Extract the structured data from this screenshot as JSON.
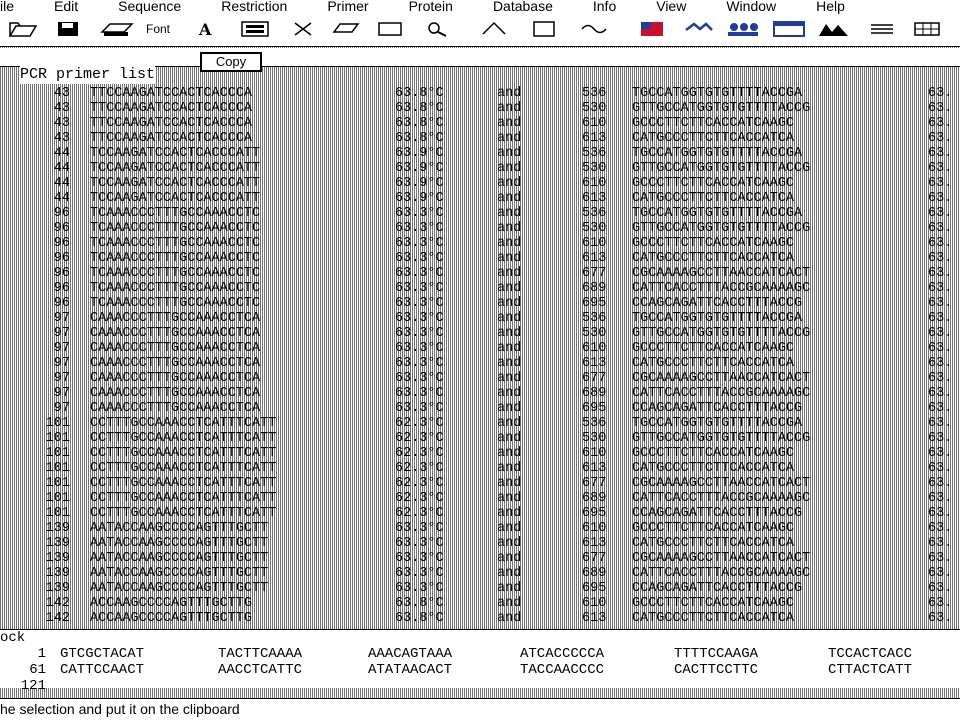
{
  "menu": [
    "ile",
    "Edit",
    "Sequence",
    "Restriction",
    "Primer",
    "Protein",
    "Database",
    "Info",
    "View",
    "Window",
    "Help"
  ],
  "toolbar": {
    "font_label": "Font",
    "icons": [
      "open-folder-icon",
      "save-disk-icon",
      "print-icon",
      "font-icon",
      "clipboard-icon",
      "cut-icon",
      "copy-icon",
      "paste-icon",
      "search-icon",
      "flag-icon",
      "bird-icon",
      "people-icon",
      "window-icon",
      "mountains-icon",
      "lines-icon",
      "grid-icon"
    ]
  },
  "copy_button": "Copy",
  "list_title": "PCR primer list",
  "primers": [
    {
      "pos": "43",
      "seq": "TTCCAAGATCCACTCACCCA",
      "tm": "63.8°C",
      "and": "and",
      "pos2": "536",
      "seq2": "TGCCATGGTGTGTTTTACCGA",
      "tm2": "63."
    },
    {
      "pos": "43",
      "seq": "TTCCAAGATCCACTCACCCA",
      "tm": "63.8°C",
      "and": "and",
      "pos2": "530",
      "seq2": "GTTGCCATGGTGTGTTTTACCG",
      "tm2": "63."
    },
    {
      "pos": "43",
      "seq": "TTCCAAGATCCACTCACCCA",
      "tm": "63.8°C",
      "and": "and",
      "pos2": "610",
      "seq2": "GCCCTTCTTCACCATCAAGC",
      "tm2": "63."
    },
    {
      "pos": "43",
      "seq": "TTCCAAGATCCACTCACCCA",
      "tm": "63.8°C",
      "and": "and",
      "pos2": "613",
      "seq2": "CATGCCCTTCTTCACCATCA",
      "tm2": "63."
    },
    {
      "pos": "44",
      "seq": "TCCAAGATCCACTCACCCATT",
      "tm": "63.9°C",
      "and": "and",
      "pos2": "536",
      "seq2": "TGCCATGGTGTGTTTTACCGA",
      "tm2": "63."
    },
    {
      "pos": "44",
      "seq": "TCCAAGATCCACTCACCCATT",
      "tm": "63.9°C",
      "and": "and",
      "pos2": "530",
      "seq2": "GTTGCCATGGTGTGTTTTACCG",
      "tm2": "63."
    },
    {
      "pos": "44",
      "seq": "TCCAAGATCCACTCACCCATT",
      "tm": "63.9°C",
      "and": "and",
      "pos2": "610",
      "seq2": "GCCCTTCTTCACCATCAAGC",
      "tm2": "63."
    },
    {
      "pos": "44",
      "seq": "TCCAAGATCCACTCACCCATT",
      "tm": "63.9°C",
      "and": "and",
      "pos2": "613",
      "seq2": "CATGCCCTTCTTCACCATCA",
      "tm2": "63."
    },
    {
      "pos": "96",
      "seq": "TCAAACCCTTTGCCAAACCTC",
      "tm": "63.3°C",
      "and": "and",
      "pos2": "536",
      "seq2": "TGCCATGGTGTGTTTTACCGA",
      "tm2": "63."
    },
    {
      "pos": "96",
      "seq": "TCAAACCCTTTGCCAAACCTC",
      "tm": "63.3°C",
      "and": "and",
      "pos2": "530",
      "seq2": "GTTGCCATGGTGTGTTTTACCG",
      "tm2": "63."
    },
    {
      "pos": "96",
      "seq": "TCAAACCCTTTGCCAAACCTC",
      "tm": "63.3°C",
      "and": "and",
      "pos2": "610",
      "seq2": "GCCCTTCTTCACCATCAAGC",
      "tm2": "63."
    },
    {
      "pos": "96",
      "seq": "TCAAACCCTTTGCCAAACCTC",
      "tm": "63.3°C",
      "and": "and",
      "pos2": "613",
      "seq2": "CATGCCCTTCTTCACCATCA",
      "tm2": "63."
    },
    {
      "pos": "96",
      "seq": "TCAAACCCTTTGCCAAACCTC",
      "tm": "63.3°C",
      "and": "and",
      "pos2": "677",
      "seq2": "CGCAAAAGCCTTAACCATCACT",
      "tm2": "63."
    },
    {
      "pos": "96",
      "seq": "TCAAACCCTTTGCCAAACCTC",
      "tm": "63.3°C",
      "and": "and",
      "pos2": "689",
      "seq2": "CATTCACCTTTACCGCAAAAGC",
      "tm2": "63."
    },
    {
      "pos": "96",
      "seq": "TCAAACCCTTTGCCAAACCTC",
      "tm": "63.3°C",
      "and": "and",
      "pos2": "695",
      "seq2": "CCAGCAGATTCACCTTTACCG",
      "tm2": "63."
    },
    {
      "pos": "97",
      "seq": "CAAACCCTTTGCCAAACCTCA",
      "tm": "63.3°C",
      "and": "and",
      "pos2": "536",
      "seq2": "TGCCATGGTGTGTTTTACCGA",
      "tm2": "63."
    },
    {
      "pos": "97",
      "seq": "CAAACCCTTTGCCAAACCTCA",
      "tm": "63.3°C",
      "and": "and",
      "pos2": "530",
      "seq2": "GTTGCCATGGTGTGTTTTACCG",
      "tm2": "63."
    },
    {
      "pos": "97",
      "seq": "CAAACCCTTTGCCAAACCTCA",
      "tm": "63.3°C",
      "and": "and",
      "pos2": "610",
      "seq2": "GCCCTTCTTCACCATCAAGC",
      "tm2": "63."
    },
    {
      "pos": "97",
      "seq": "CAAACCCTTTGCCAAACCTCA",
      "tm": "63.3°C",
      "and": "and",
      "pos2": "613",
      "seq2": "CATGCCCTTCTTCACCATCA",
      "tm2": "63."
    },
    {
      "pos": "97",
      "seq": "CAAACCCTTTGCCAAACCTCA",
      "tm": "63.3°C",
      "and": "and",
      "pos2": "677",
      "seq2": "CGCAAAAGCCTTAACCATCACT",
      "tm2": "63."
    },
    {
      "pos": "97",
      "seq": "CAAACCCTTTGCCAAACCTCA",
      "tm": "63.3°C",
      "and": "and",
      "pos2": "689",
      "seq2": "CATTCACCTTTACCGCAAAAGC",
      "tm2": "63."
    },
    {
      "pos": "97",
      "seq": "CAAACCCTTTGCCAAACCTCA",
      "tm": "63.3°C",
      "and": "and",
      "pos2": "695",
      "seq2": "CCAGCAGATTCACCTTTACCG",
      "tm2": "63."
    },
    {
      "pos": "101",
      "seq": "CCTTTGCCAAACCTCATTTCATT",
      "tm": "62.3°C",
      "and": "and",
      "pos2": "536",
      "seq2": "TGCCATGGTGTGTTTTACCGA",
      "tm2": "63."
    },
    {
      "pos": "101",
      "seq": "CCTTTGCCAAACCTCATTTCATT",
      "tm": "62.3°C",
      "and": "and",
      "pos2": "530",
      "seq2": "GTTGCCATGGTGTGTTTTACCG",
      "tm2": "63."
    },
    {
      "pos": "101",
      "seq": "CCTTTGCCAAACCTCATTTCATT",
      "tm": "62.3°C",
      "and": "and",
      "pos2": "610",
      "seq2": "GCCCTTCTTCACCATCAAGC",
      "tm2": "63."
    },
    {
      "pos": "101",
      "seq": "CCTTTGCCAAACCTCATTTCATT",
      "tm": "62.3°C",
      "and": "and",
      "pos2": "613",
      "seq2": "CATGCCCTTCTTCACCATCA",
      "tm2": "63."
    },
    {
      "pos": "101",
      "seq": "CCTTTGCCAAACCTCATTTCATT",
      "tm": "62.3°C",
      "and": "and",
      "pos2": "677",
      "seq2": "CGCAAAAGCCTTAACCATCACT",
      "tm2": "63."
    },
    {
      "pos": "101",
      "seq": "CCTTTGCCAAACCTCATTTCATT",
      "tm": "62.3°C",
      "and": "and",
      "pos2": "689",
      "seq2": "CATTCACCTTTACCGCAAAAGC",
      "tm2": "63."
    },
    {
      "pos": "101",
      "seq": "CCTTTGCCAAACCTCATTTCATT",
      "tm": "62.3°C",
      "and": "and",
      "pos2": "695",
      "seq2": "CCAGCAGATTCACCTTTACCG",
      "tm2": "63."
    },
    {
      "pos": "139",
      "seq": "AATACCAAGCCCCAGTTTGCTT",
      "tm": "63.3°C",
      "and": "and",
      "pos2": "610",
      "seq2": "GCCCTTCTTCACCATCAAGC",
      "tm2": "63."
    },
    {
      "pos": "139",
      "seq": "AATACCAAGCCCCAGTTTGCTT",
      "tm": "63.3°C",
      "and": "and",
      "pos2": "613",
      "seq2": "CATGCCCTTCTTCACCATCA",
      "tm2": "63."
    },
    {
      "pos": "139",
      "seq": "AATACCAAGCCCCAGTTTGCTT",
      "tm": "63.3°C",
      "and": "and",
      "pos2": "677",
      "seq2": "CGCAAAAGCCTTAACCATCACT",
      "tm2": "63."
    },
    {
      "pos": "139",
      "seq": "AATACCAAGCCCCAGTTTGCTT",
      "tm": "63.3°C",
      "and": "and",
      "pos2": "689",
      "seq2": "CATTCACCTTTACCGCAAAAGC",
      "tm2": "63."
    },
    {
      "pos": "139",
      "seq": "AATACCAAGCCCCAGTTTGCTT",
      "tm": "63.3°C",
      "and": "and",
      "pos2": "695",
      "seq2": "CCAGCAGATTCACCTTTACCG",
      "tm2": "63."
    },
    {
      "pos": "142",
      "seq": "ACCAAGCCCCAGTTTGCTTG",
      "tm": "63.8°C",
      "and": "and",
      "pos2": "610",
      "seq2": "GCCCTTCTTCACCATCAAGC",
      "tm2": "63."
    },
    {
      "pos": "142",
      "seq": "ACCAAGCCCCAGTTTGCTTG",
      "tm": "63.8°C",
      "and": "and",
      "pos2": "613",
      "seq2": "CATGCCCTTCTTCACCATCA",
      "tm2": "63."
    }
  ],
  "sequence_view": {
    "label": "ock",
    "rows": [
      {
        "num": "1",
        "blocks": [
          "GTCGCTACAT",
          "TACTTCAAAA",
          "AAACAGTAAA",
          "ATCACCCCCA",
          "TTTTCCAAGA",
          "TCCACTCACC"
        ]
      },
      {
        "num": "61",
        "blocks": [
          "CATTCCAACT",
          "AACCTCATTC",
          "ATATAACACT",
          "TACCAACCCC",
          "CACTTCCTTC",
          "CTTACTCATT"
        ]
      },
      {
        "num": "121",
        "blocks": []
      }
    ]
  },
  "status_text": "he selection and put it on the clipboard"
}
